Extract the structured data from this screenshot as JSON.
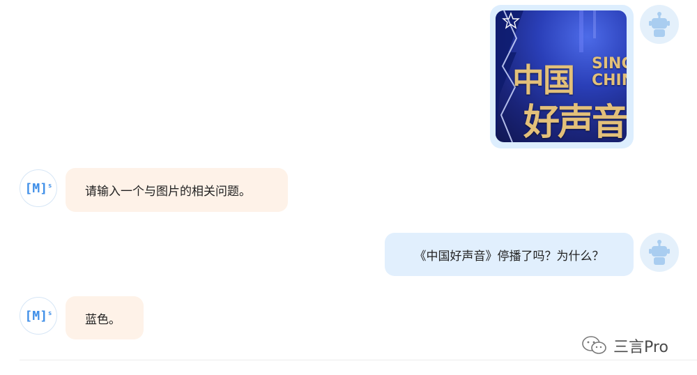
{
  "messages": [
    {
      "role": "user",
      "type": "image",
      "poster": {
        "title_line1": "中国",
        "title_line2": "好声音",
        "en_line1": "SING",
        "en_line2": "CHIN"
      }
    },
    {
      "role": "bot",
      "type": "text",
      "text": "请输入一个与图片的相关问题。"
    },
    {
      "role": "user",
      "type": "text",
      "text": "《中国好声音》停播了吗？为什么？"
    },
    {
      "role": "bot",
      "type": "text",
      "text": "蓝色。"
    }
  ],
  "bot_avatar": {
    "label": "[M]",
    "sup": "s"
  },
  "watermark": {
    "text": "三言Pro",
    "icon": "wechat-icon"
  },
  "colors": {
    "user_bubble": "#e1effd",
    "bot_bubble": "#fef2e8",
    "bot_avatar_accent": "#3e8ee8",
    "user_avatar_bg": "#e4f0fb"
  }
}
